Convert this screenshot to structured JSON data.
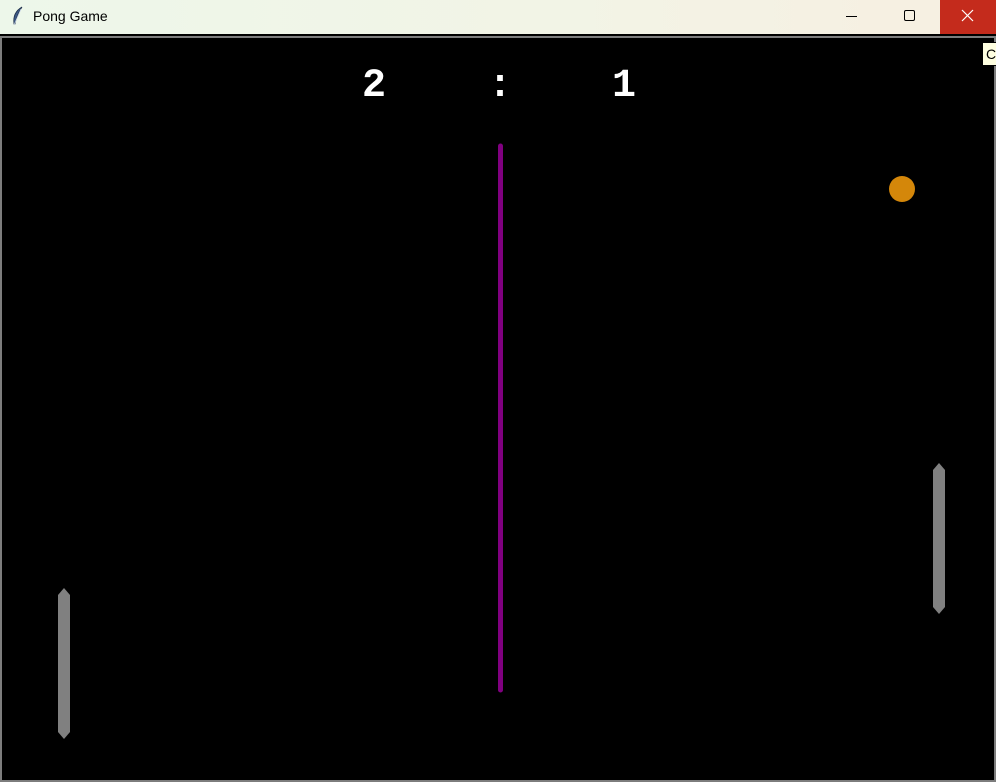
{
  "window": {
    "title": "Pong Game",
    "icon": "feather-icon",
    "controls": [
      "minimize-icon",
      "maximize-icon",
      "close-icon"
    ]
  },
  "scoreboard": {
    "left_score": "2",
    "separator": ":",
    "right_score": "1"
  },
  "tooltip": {
    "text": "C"
  },
  "colors": {
    "background": "#000000",
    "score": "#ffffff",
    "center_line": "#800080",
    "paddle": "#808080",
    "ball": "#d4870a",
    "close_button": "#c42b1c"
  }
}
